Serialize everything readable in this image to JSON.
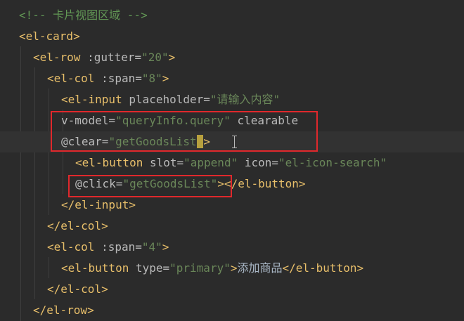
{
  "editor": {
    "lines": [
      {
        "comment": "<!-- 卡片视图区域 -->"
      },
      {
        "open": "<el-card>"
      },
      {
        "tag_open": "<el-row ",
        "attr": ":gutter=",
        "value": "\"20\"",
        "close": ">"
      },
      {
        "tag_open": "<el-col ",
        "attr": ":span=",
        "value": "\"8\"",
        "close": ">"
      },
      {
        "tag_open": "<el-input ",
        "attr": "placeholder=",
        "value": "\"请输入内容\""
      },
      {
        "attr": "v-model=",
        "value": "\"queryInfo.query\"",
        "attr2": " clearable"
      },
      {
        "attr": "@clear=",
        "value_a": "\"getGoodsList",
        "cursor_char": "\"",
        "close": ">"
      },
      {
        "tag_open": "<el-button ",
        "attr": "slot=",
        "value": "\"append\"",
        "attr2": " icon=",
        "value2": "\"el-icon-search\""
      },
      {
        "attr": "@click=",
        "value": "\"getGoodsList\"",
        "close_tag": "></el-button>"
      },
      {
        "close_tag": "</el-input>"
      },
      {
        "close_tag": "</el-col>"
      },
      {
        "tag_open": "<el-col ",
        "attr": ":span=",
        "value": "\"4\"",
        "close": ">"
      },
      {
        "tag_open": "<el-button ",
        "attr": "type=",
        "value": "\"primary\"",
        "close": ">",
        "text": "添加商品",
        "close_tag": "</el-button>"
      },
      {
        "close_tag": "</el-col>"
      },
      {
        "close_tag": "</el-row>"
      }
    ]
  },
  "colors": {
    "background": "#2b2b2b",
    "comment": "#629755",
    "tag": "#e8bf6a",
    "attribute": "#bababa",
    "string": "#6a8759",
    "highlight_box": "#e0282c",
    "cursor_highlight": "#b7a03e"
  },
  "icons": {
    "text_cursor": "i-beam-icon"
  }
}
